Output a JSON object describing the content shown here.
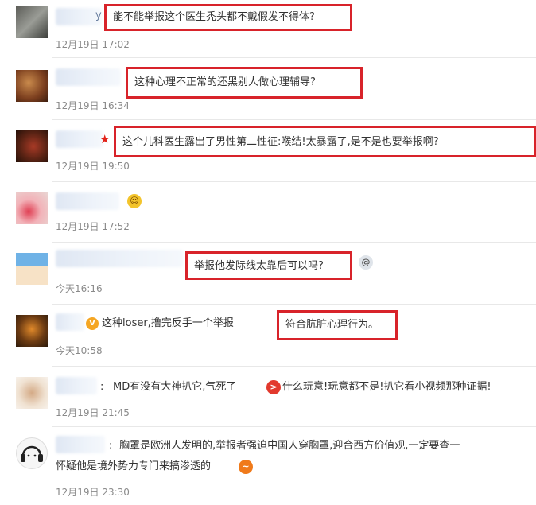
{
  "comments": [
    {
      "name_suffix": "y",
      "text": "能不能举报这个医生秃头都不戴假发不得体?",
      "time": "12月19日 17:02",
      "avatar_icon": "photo-avatar-dark"
    },
    {
      "name_suffix": "",
      "text": "这种心理不正常的还黑别人做心理辅导?",
      "time": "12月19日 16:34",
      "avatar_icon": "photo-avatar-brown"
    },
    {
      "name_suffix": "",
      "text": "这个儿科医生露出了男性第二性征:喉结!太暴露了,是不是也要举报啊?",
      "time": "12月19日 19:50",
      "avatar_icon": "photo-avatar-red"
    },
    {
      "name_suffix": "",
      "text": "",
      "time": "12月19日 17:52",
      "avatar_icon": "photo-avatar-pink",
      "emoji": "laughing-emoji"
    },
    {
      "name_suffix": "",
      "text": "举报他发际线太靠后可以吗?",
      "time": "今天16:16",
      "avatar_icon": "cartoon-avatar-boy",
      "emoji": "dizzy-emoji"
    },
    {
      "name_suffix": "",
      "text_plain": "这种loser,撸完反手一个举报",
      "text": "符合肮脏心理行为。",
      "time": "今天10:58",
      "avatar_icon": "cartoon-avatar-glasses"
    },
    {
      "name_suffix": "",
      "text_plain": "MD有没有大神扒它,气死了",
      "text_after": "什么玩意!玩意都不是!扒它看小视频那种证据!",
      "time": "12月19日 21:45",
      "avatar_icon": "drawing-avatar",
      "emoji": "angry-emoji"
    },
    {
      "name_suffix": "",
      "text_plain": "胸罩是欧洲人发明的,举报者强迫中国人穿胸罩,迎合西方价值观,一定要查一",
      "text_line2": "怀疑他是境外势力专门来搞渗透的",
      "time": "12月19日 23:30",
      "avatar_icon": "headphone-avatar",
      "emoji": "smug-emoji"
    }
  ],
  "colors": {
    "highlight": "#d8232a",
    "time": "#8a8a8a",
    "badge": "#f5a623"
  }
}
